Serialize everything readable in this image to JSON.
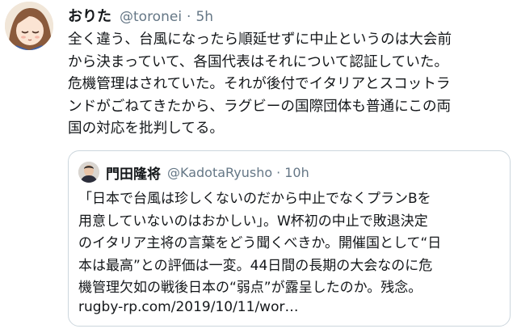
{
  "tweet": {
    "display_name": "おりた",
    "handle": "@toronei",
    "separator": "·",
    "time": "5h",
    "lines": [
      "全く違う、台風になったら順延せずに中止というのは大会前",
      "から決まっていて、各国代表はそれについて認証していた。",
      "危機管理はされていた。それが後付でイタリアとスコットラ",
      "ンドがごねてきたから、ラグビーの国際団体も普通にこの両",
      "国の対応を批判してる。"
    ]
  },
  "quoted": {
    "display_name": "門田隆将",
    "handle": "@KadotaRyusho",
    "separator": "·",
    "time": "10h",
    "lines": [
      "「日本で台風は珍しくないのだから中止でなくプランBを",
      "用意していないのはおかしい」。W杯初の中止で敗退決定",
      "のイタリア主将の言葉をどう聞くべきか。開催国として“日",
      "本は最高”との評価は一変。44日間の長期の大会なのに危",
      "機管理欠如の戦後日本の“弱点”が露呈したのか。残念。"
    ],
    "link": "rugby-rp.com/2019/10/11/wor…"
  },
  "colors": {
    "text": "#14171a",
    "secondary": "#657786",
    "border": "#ccd6dd"
  }
}
